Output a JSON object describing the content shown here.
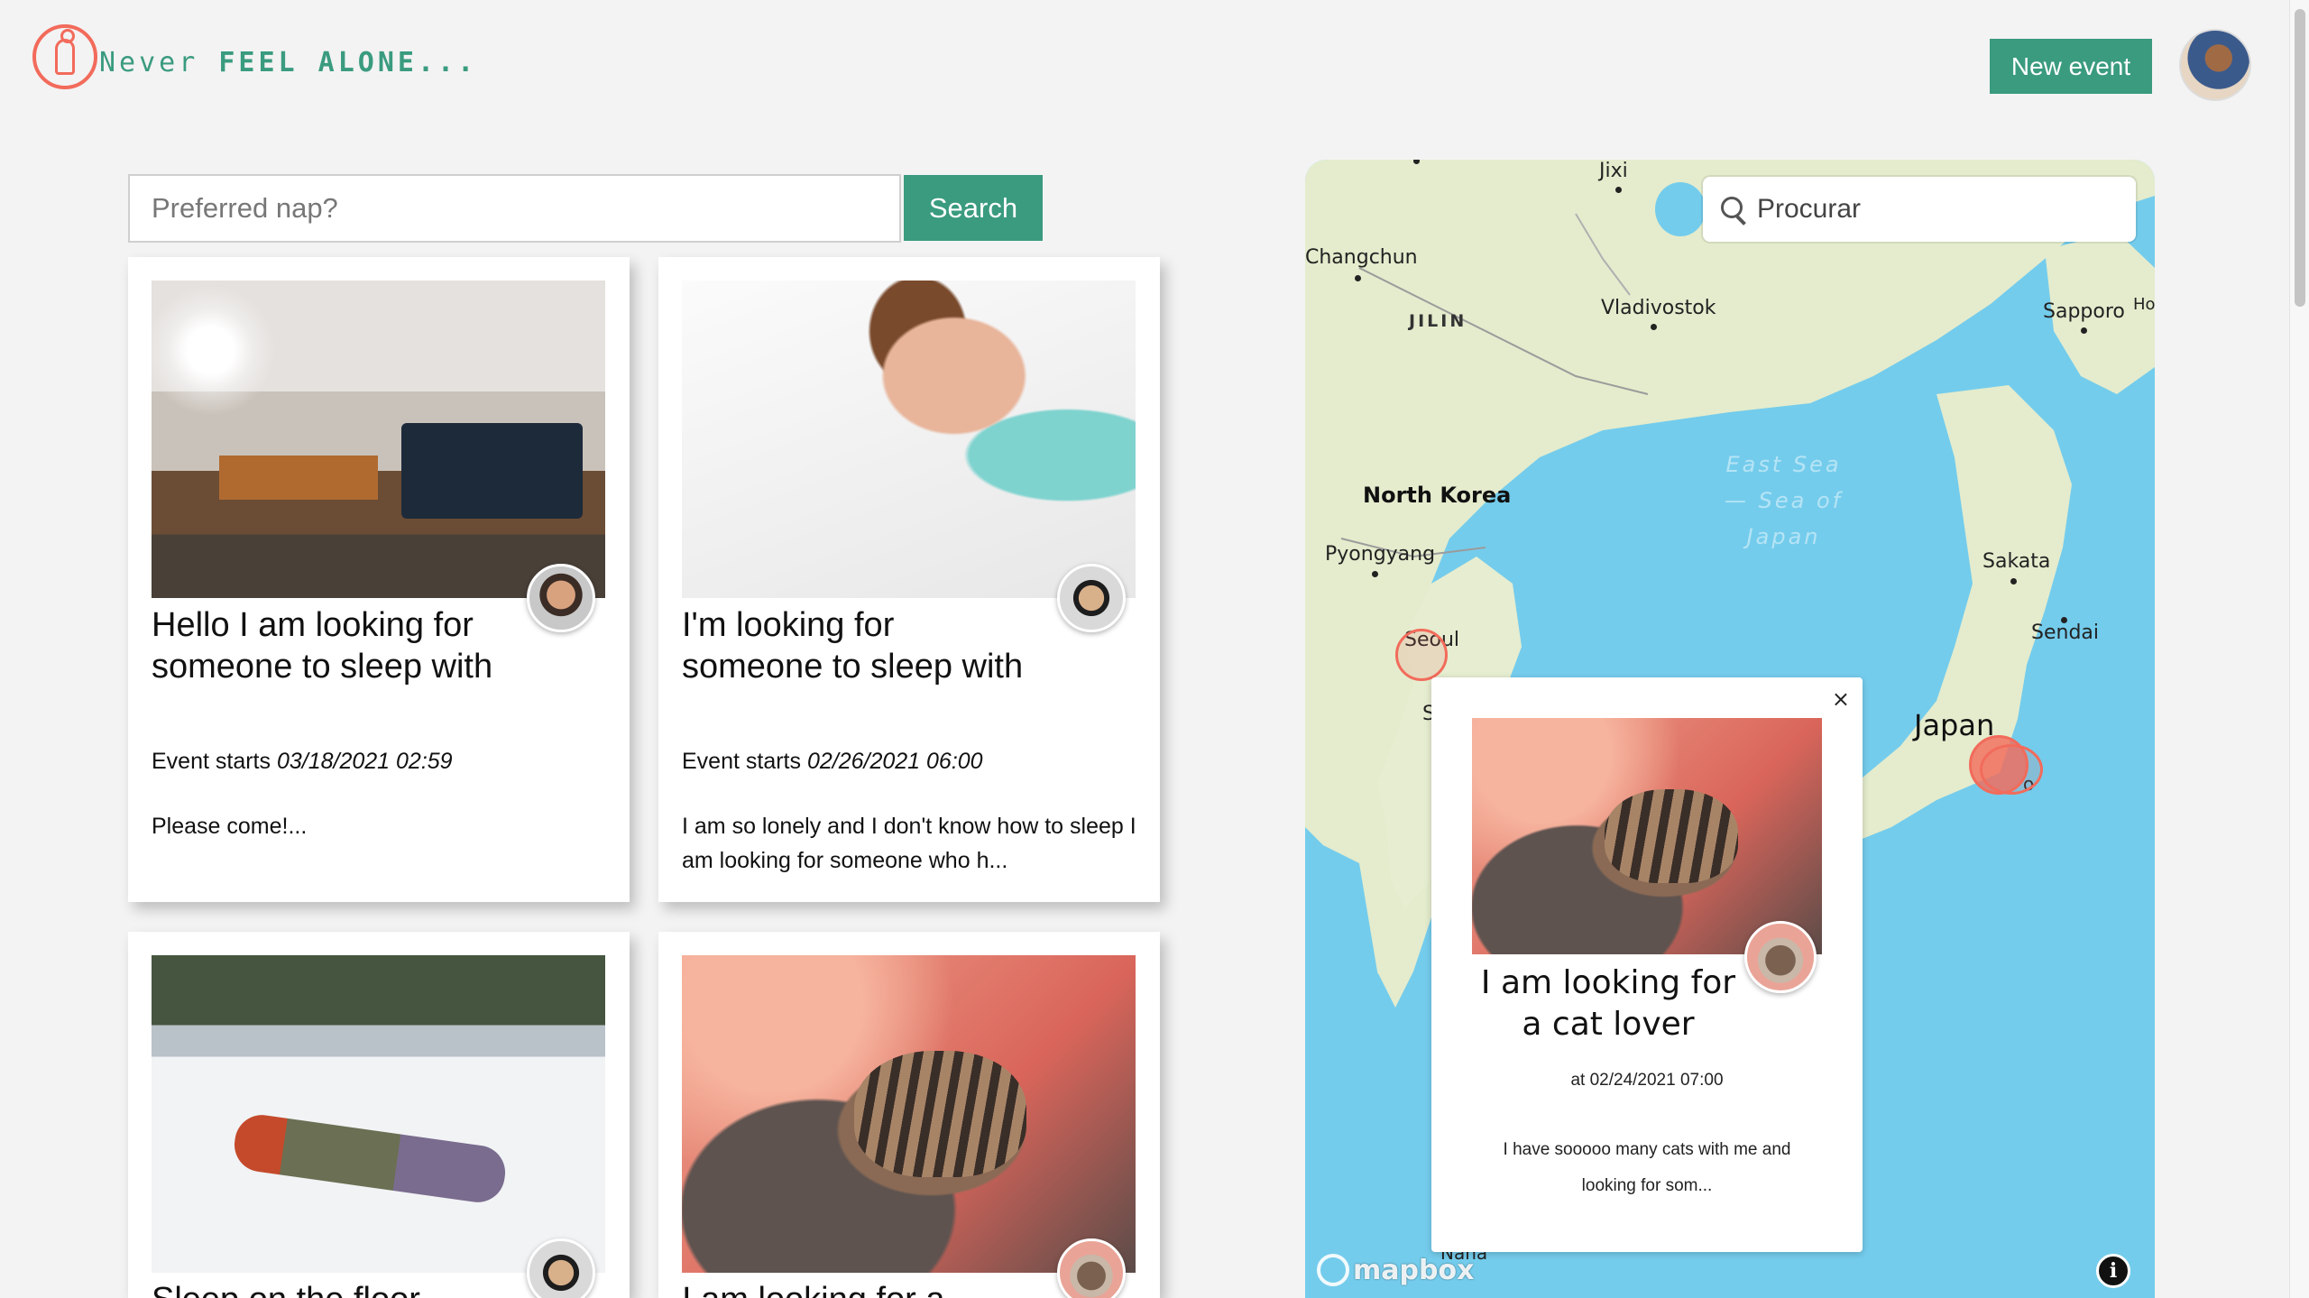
{
  "header": {
    "logo_never": "Never",
    "logo_feel_alone": "FEEL ALONE...",
    "new_event_label": "New event"
  },
  "search": {
    "placeholder": "Preferred nap?",
    "button_label": "Search"
  },
  "cards": [
    {
      "title": "Hello I am looking for someone to sleep with",
      "starts_label": "Event starts",
      "starts_time": "03/18/2021 02:59",
      "description": "Please come!..."
    },
    {
      "title": "I'm looking for someone to sleep with",
      "starts_label": "Event starts",
      "starts_time": "02/26/2021 06:00",
      "description": "I am so lonely and I don't know how to sleep I am looking for someone who h..."
    },
    {
      "title": "Sleep on the floor",
      "starts_label": "",
      "starts_time": "",
      "description": ""
    },
    {
      "title": "I am looking for a",
      "starts_label": "",
      "starts_time": "",
      "description": ""
    }
  ],
  "map": {
    "search_placeholder": "Procurar",
    "labels": {
      "jixi": "Jixi",
      "changchun": "Changchun",
      "jilin": "JILIN",
      "vladivostok": "Vladivostok",
      "sapporo": "Sapporo",
      "ho": "Ho",
      "east_sea": "East Sea",
      "sea_of": "— Sea of",
      "japan_sea": "Japan",
      "north_korea": "North Korea",
      "pyongyang": "Pyongyang",
      "sakata": "Sakata",
      "sendai": "Sendai",
      "seoul": "Seoul",
      "japan": "Japan",
      "s": "S",
      "o": "o",
      "naha": "Naha"
    },
    "attribution": "mapbox",
    "info": "i",
    "colors": {
      "water": "#74ccec",
      "land": "#e4eccd",
      "marker": "#f26b5b"
    }
  },
  "popup": {
    "close": "×",
    "title": "I am looking for a cat lover",
    "time": "at 02/24/2021 07:00",
    "description": "I have sooooo many cats with me and looking for som..."
  },
  "colors": {
    "accent": "#3a9b7f",
    "logo": "#f26b5b"
  }
}
